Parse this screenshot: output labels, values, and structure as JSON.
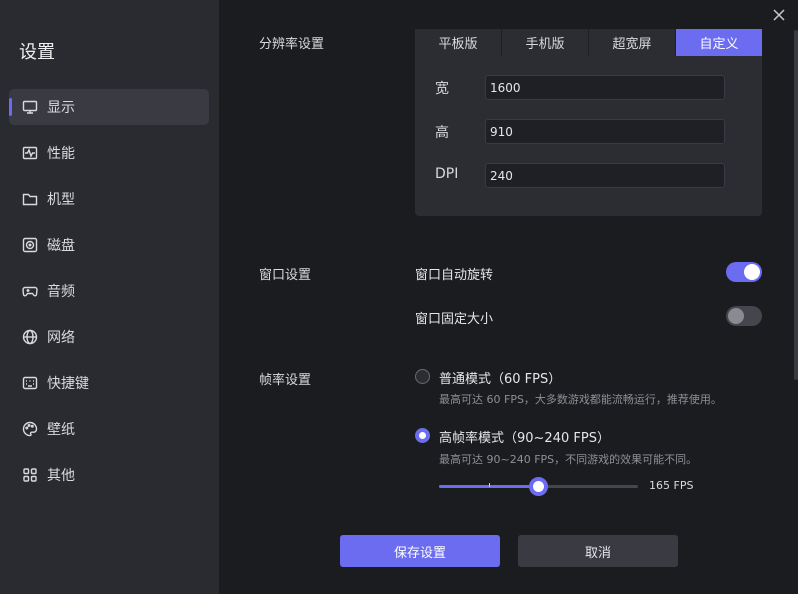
{
  "sidebar": {
    "title": "设置",
    "items": [
      {
        "label": "显示",
        "icon": "monitor-icon",
        "active": true
      },
      {
        "label": "性能",
        "icon": "pulse-icon"
      },
      {
        "label": "机型",
        "icon": "folder-icon"
      },
      {
        "label": "磁盘",
        "icon": "disk-icon"
      },
      {
        "label": "音频",
        "icon": "gamepad-icon"
      },
      {
        "label": "网络",
        "icon": "globe-icon"
      },
      {
        "label": "快捷键",
        "icon": "keyboard-icon"
      },
      {
        "label": "壁纸",
        "icon": "palette-icon"
      },
      {
        "label": "其他",
        "icon": "grid-icon"
      }
    ]
  },
  "resolution": {
    "section_label": "分辨率设置",
    "tabs": [
      "平板版",
      "手机版",
      "超宽屏",
      "自定义"
    ],
    "active_tab": "自定义",
    "width_label": "宽",
    "width_value": "1600",
    "height_label": "高",
    "height_value": "910",
    "dpi_label": "DPI",
    "dpi_value": "240"
  },
  "window": {
    "section_label": "窗口设置",
    "auto_rotate_label": "窗口自动旋转",
    "auto_rotate_on": true,
    "fixed_size_label": "窗口固定大小",
    "fixed_size_on": false
  },
  "framerate": {
    "section_label": "帧率设置",
    "normal_label": "普通模式（60 FPS）",
    "normal_desc": "最高可达 60 FPS，大多数游戏都能流畅运行，推荐使用。",
    "high_label": "高帧率模式（90~240 FPS）",
    "high_desc": "最高可达 90~240 FPS，不同游戏的效果可能不同。",
    "selected": "high",
    "slider_min": 90,
    "slider_max": 240,
    "slider_value": 165,
    "slider_value_label": "165 FPS"
  },
  "actions": {
    "save_label": "保存设置",
    "cancel_label": "取消"
  },
  "colors": {
    "accent": "#6b6cf0",
    "sidebar_bg": "#2a2b31",
    "main_bg": "#1b1c20"
  }
}
